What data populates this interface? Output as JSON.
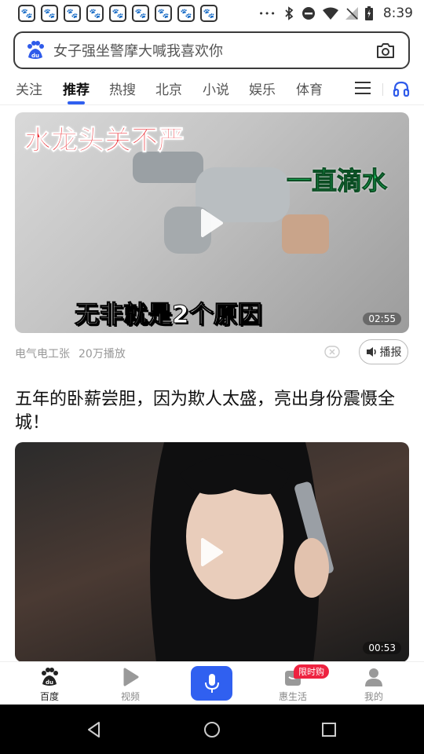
{
  "status_bar": {
    "time": "8:39",
    "notification_icon_names": [
      "baidu-paw-icon",
      "baidu-paw-icon",
      "baidu-paw-icon",
      "baidu-paw-icon",
      "baidu-paw-icon",
      "baidu-paw-icon",
      "baidu-paw-icon",
      "baidu-paw-icon",
      "baidu-paw-icon"
    ],
    "more_text": "•••"
  },
  "search": {
    "text": "女子强坐警摩大喊我喜欢你"
  },
  "tabs": [
    {
      "label": "关注"
    },
    {
      "label": "推荐",
      "active": true
    },
    {
      "label": "热搜"
    },
    {
      "label": "北京"
    },
    {
      "label": "小说"
    },
    {
      "label": "娱乐"
    },
    {
      "label": "体育"
    }
  ],
  "feed": {
    "item1": {
      "overlay_red": "水龙头关不严",
      "overlay_green": "一直滴水",
      "overlay_white": "无非就是2个原因",
      "duration": "02:55",
      "source": "电气电工张",
      "plays": "20万播放",
      "broadcast_label": "播报"
    },
    "item2": {
      "title": "五年的卧薪尝胆，因为欺人太盛，亮出身份震慑全城！",
      "duration": "00:53"
    }
  },
  "bottom_nav": {
    "home": "百度",
    "video": "视频",
    "life": "惠生活",
    "mine": "我的",
    "promo_badge": "限时购"
  },
  "colors": {
    "accent": "#3060f0",
    "badge": "#ee2240"
  }
}
